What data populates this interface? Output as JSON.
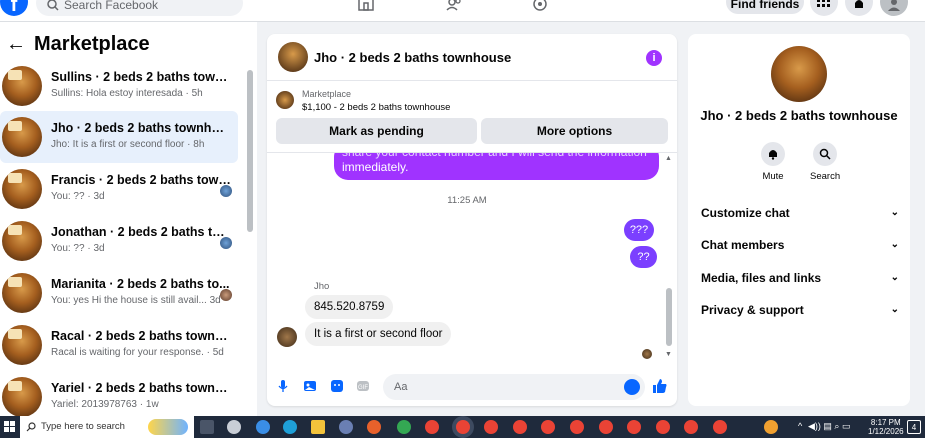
{
  "topbar": {
    "logo": "f",
    "search_placeholder": "Search Facebook",
    "find_friends": "Find friends"
  },
  "marketplace": {
    "title": "Marketplace",
    "back_arrow": "←",
    "conversations": [
      {
        "title": "Sullins · 2 beds 2 baths townhou...",
        "subtitle": "Sullins: Hola estoy interesada · 5h",
        "selected": false
      },
      {
        "title": "Jho · 2 beds 2 baths townhouse",
        "subtitle": "Jho: It is a first or second floor · 8h",
        "selected": true
      },
      {
        "title": "Francis · 2 beds 2 baths town...",
        "subtitle": "You: ?? · 3d",
        "selected": false
      },
      {
        "title": "Jonathan · 2 beds 2 baths tow...",
        "subtitle": "You: ?? · 3d",
        "selected": false
      },
      {
        "title": "Marianita · 2 beds 2 baths to...",
        "subtitle": "You: yes Hi the house is still avail... 3d",
        "selected": false
      },
      {
        "title": "Racal · 2 beds 2 baths townhouse",
        "subtitle": "Racal is waiting for your response. · 5d",
        "selected": false
      },
      {
        "title": "Yariel · 2 beds 2 baths townhouse",
        "subtitle": "Yariel: 2013978763 · 1w",
        "selected": false
      }
    ]
  },
  "chat": {
    "header_name": "Jho · 2 beds 2 baths townhouse",
    "info_icon": "i",
    "marketplace_label": "Marketplace",
    "listing": "$1,100 - 2 beds 2 baths townhouse",
    "mark_pending": "Mark as pending",
    "more_options": "More options",
    "sent_long_top": "share your contact number and I will send the information",
    "sent_long_bottom": "immediately.",
    "timestamp": "11:25 AM",
    "sent_1": "???",
    "sent_2": "??",
    "sender": "Jho",
    "recv_1": "845.520.8759",
    "recv_2": "It is a first or second floor",
    "composer_placeholder": "Aa"
  },
  "details": {
    "name": "Jho · 2 beds 2 baths townhouse",
    "mute": "Mute",
    "search": "Search",
    "sections": [
      "Customize chat",
      "Chat members",
      "Media, files and links",
      "Privacy & support"
    ],
    "chevron": "⌄"
  },
  "taskbar": {
    "search_placeholder": "Type here to search",
    "time": "8:17 PM",
    "date": "1/12/2026",
    "notifications": "4"
  },
  "colors": {
    "accent": "#0866ff",
    "messenger_purple": "#a033ff"
  }
}
